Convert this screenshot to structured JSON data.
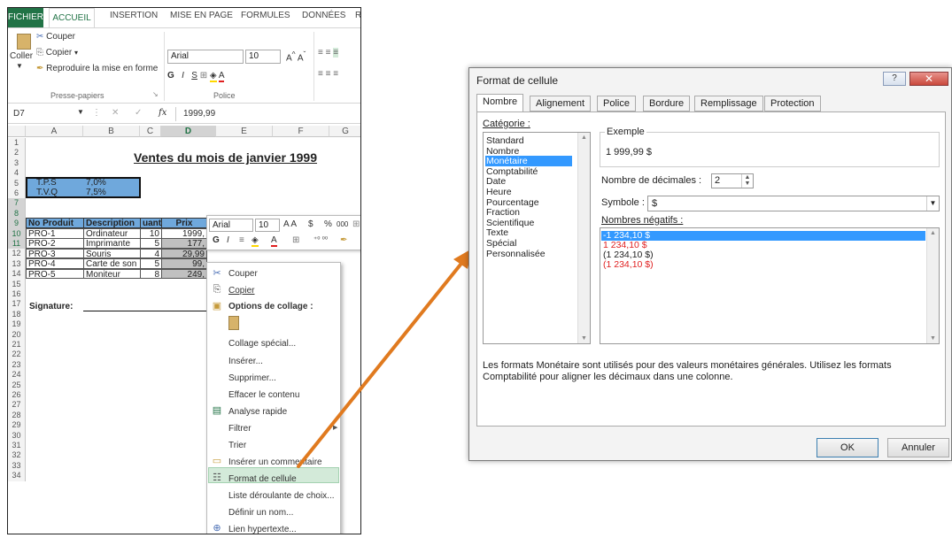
{
  "excel": {
    "tabs": [
      "FICHIER",
      "ACCUEIL",
      "INSERTION",
      "MISE EN PAGE",
      "FORMULES",
      "DONNÉES",
      "R"
    ],
    "clipboard": {
      "paste": "Coller",
      "cut": "Couper",
      "copy": "Copier",
      "format_painter": "Reproduire la mise en forme",
      "group_label": "Presse-papiers"
    },
    "font": {
      "name": "Arial",
      "size": "10",
      "bold": "G",
      "italic": "I",
      "underline": "S",
      "group_label": "Police"
    },
    "formula_bar": {
      "cell_ref": "D7",
      "fx": "fx",
      "value": "1999,99"
    },
    "columns": [
      "A",
      "B",
      "C",
      "D",
      "E",
      "F",
      "G"
    ],
    "rows": [
      "1",
      "2",
      "3",
      "4",
      "5",
      "6",
      "7",
      "8",
      "9",
      "10",
      "11",
      "12",
      "13",
      "14",
      "15",
      "16",
      "17",
      "18",
      "19",
      "20",
      "21",
      "22",
      "23",
      "24",
      "25",
      "26",
      "27",
      "28",
      "29",
      "30",
      "31",
      "32",
      "33",
      "34"
    ],
    "sheet": {
      "title": "Ventes du mois de janvier 1999",
      "tps_label": "T.P.S",
      "tps_value": "7,0%",
      "tvq_label": "T.V.Q",
      "tvq_value": "7,5%",
      "headers": [
        "No Produit",
        "Description",
        "uanti",
        "Prix"
      ],
      "products": [
        {
          "no": "PRO-1",
          "desc": "Ordinateur",
          "qty": "10",
          "price": "1999,"
        },
        {
          "no": "PRO-2",
          "desc": "Imprimante",
          "qty": "5",
          "price": "177,"
        },
        {
          "no": "PRO-3",
          "desc": "Souris",
          "qty": "4",
          "price": "29,99"
        },
        {
          "no": "PRO-4",
          "desc": "Carte de son",
          "qty": "5",
          "price": "99,"
        },
        {
          "no": "PRO-5",
          "desc": "Moniteur",
          "qty": "8",
          "price": "249,"
        }
      ],
      "signature": "Signature:"
    },
    "mini_toolbar": {
      "font": "Arial",
      "size": "10",
      "bold": "G",
      "italic": "I",
      "currency": "$",
      "percent": "%",
      "thousands": "000"
    },
    "context_menu": {
      "cut": "Couper",
      "copy": "Copier",
      "paste_options": "Options de collage :",
      "paste_special": "Collage spécial...",
      "insert": "Insérer...",
      "delete": "Supprimer...",
      "clear": "Effacer le contenu",
      "quick_analysis": "Analyse rapide",
      "filter": "Filtrer",
      "sort": "Trier",
      "insert_comment": "Insérer un commentaire",
      "format_cells": "Format de cellule",
      "dropdown": "Liste déroulante de choix...",
      "define_name": "Définir un nom...",
      "hyperlink": "Lien hypertexte..."
    }
  },
  "dialog": {
    "title": "Format de cellule",
    "help": "?",
    "close": "✕",
    "tabs": [
      "Nombre",
      "Alignement",
      "Police",
      "Bordure",
      "Remplissage",
      "Protection"
    ],
    "category_label": "Catégorie :",
    "categories": [
      "Standard",
      "Nombre",
      "Monétaire",
      "Comptabilité",
      "Date",
      "Heure",
      "Pourcentage",
      "Fraction",
      "Scientifique",
      "Texte",
      "Spécial",
      "Personnalisée"
    ],
    "example_label": "Exemple",
    "example_value": "1 999,99 $",
    "decimals_label": "Nombre de décimales :",
    "decimals_value": "2",
    "symbol_label": "Symbole :",
    "symbol_value": "$",
    "negatives_label": "Nombres négatifs :",
    "negatives": [
      "-1 234,10 $",
      "1 234,10 $",
      "(1 234,10 $)",
      "(1 234,10 $)"
    ],
    "description_line1": "Les formats Monétaire sont utilisés pour des valeurs monétaires générales. Utilisez les formats",
    "description_line2": "Comptabilité pour aligner les décimaux dans une colonne.",
    "ok": "OK",
    "cancel": "Annuler"
  },
  "colors": {
    "excel_green": "#217346",
    "header_blue": "#6fa8dc",
    "arrow_orange": "#e07a1f",
    "selection_blue": "#3399ff",
    "negative_red": "#e02020"
  }
}
